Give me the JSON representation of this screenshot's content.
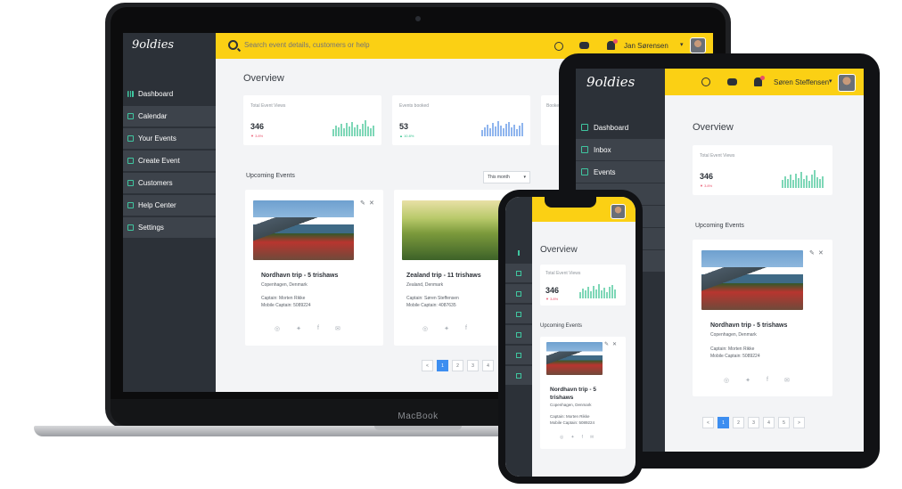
{
  "brand": {
    "logo_text": "9oldies",
    "accent": "#fbd014",
    "sidebar_bg": "#2c3138",
    "positive": "#34c38f",
    "negative": "#e8506a",
    "primary": "#3d8ef0"
  },
  "laptop": {
    "device_label": "MacBook",
    "search_placeholder": "Search event details, customers or help",
    "user_name": "Jan Sørensen",
    "nav": [
      "Dashboard",
      "Calendar",
      "Your Events",
      "Create Event",
      "Customers",
      "Help Center",
      "Settings"
    ],
    "page_title": "Overview",
    "stats": [
      {
        "label": "Total Event Views",
        "value": "346",
        "delta": "3.8%",
        "trend": "down"
      },
      {
        "label": "Events booked",
        "value": "53",
        "delta": "10.8%",
        "trend": "up"
      },
      {
        "label": "Booke",
        "value": "",
        "delta": "",
        "trend": ""
      }
    ],
    "upcoming_label": "Upcoming Events",
    "month_filter": "This month",
    "events": [
      {
        "title": "Nordhavn trip - 5 trishaws",
        "location": "Copenhagen, Denmark",
        "captain": "Captain: Morten Rikke",
        "mobile": "Mobile Captain: 5089224"
      },
      {
        "title": "Zealand trip - 11 trishaws",
        "location": "Zealand, Denmark",
        "captain": "Captain: Søren Steffensen",
        "mobile": "Mobile Captain: 4087635"
      }
    ],
    "pagination": [
      "<",
      "1",
      "2",
      "3",
      "4"
    ]
  },
  "tablet": {
    "user_name": "Søren Steffensen",
    "nav": [
      "Dashboard",
      "Inbox",
      "Events"
    ],
    "page_title": "Overview",
    "stat": {
      "label": "Total Event Views",
      "value": "346",
      "delta": "3.8%",
      "trend": "down"
    },
    "upcoming_label": "Upcoming Events",
    "event": {
      "title": "Nordhavn trip - 5 trishaws",
      "location": "Copenhagen, Denmark",
      "captain": "Captain: Morten Rikke",
      "mobile": "Mobile Captain: 5089224"
    },
    "pagination": [
      "<",
      "1",
      "2",
      "3",
      "4",
      "5",
      ">"
    ]
  },
  "phone": {
    "page_title": "Overview",
    "stat": {
      "label": "Total Event Views",
      "value": "346",
      "delta": "3.8%",
      "trend": "down"
    },
    "upcoming_label": "Upcoming Events",
    "event": {
      "title": "Nordhavn trip - 5 trishaws",
      "location": "Copenhagen, Denmark",
      "captain": "Captain: Morten Rikke",
      "mobile": "Mobile Captain: 5089224"
    }
  }
}
